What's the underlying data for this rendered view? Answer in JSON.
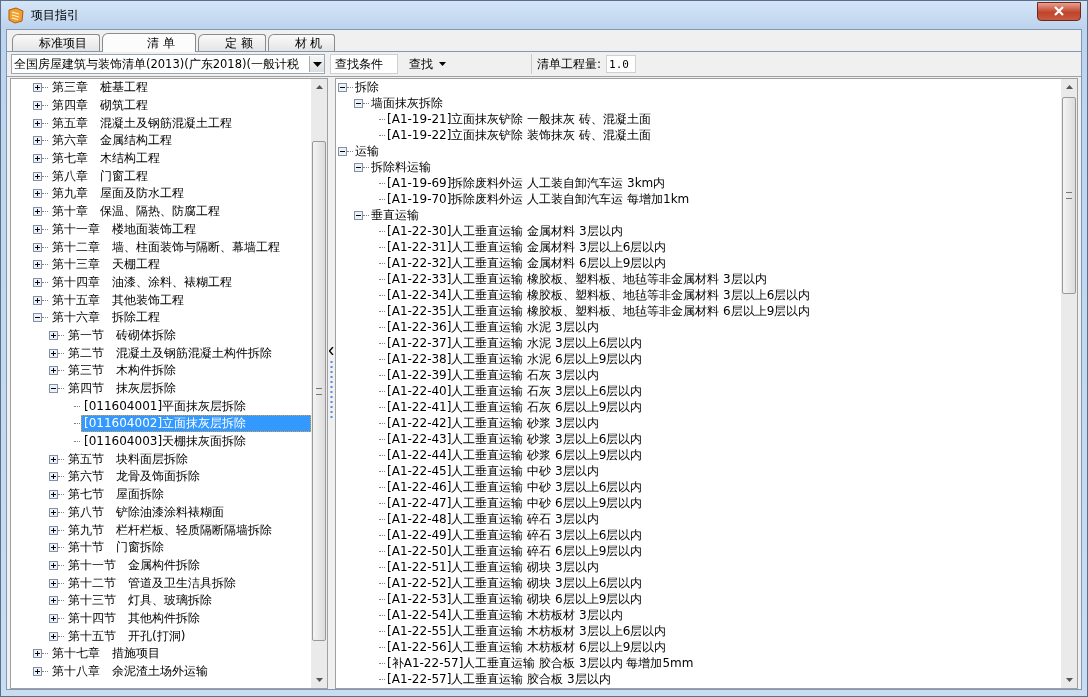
{
  "window": {
    "title": "项目指引"
  },
  "tabs": [
    {
      "label": "标准项目",
      "selected": false
    },
    {
      "label": "清 单",
      "selected": true
    },
    {
      "label": "定 额",
      "selected": false
    },
    {
      "label": "材 机",
      "selected": false
    }
  ],
  "toolbar": {
    "library": "全国房屋建筑与装饰清单(2013)(广东2018)(一般计税",
    "search_condition": "查找条件",
    "find_button": "查找",
    "quantity_label": "清单工程量:",
    "quantity_value": "1.0"
  },
  "left_tree": [
    {
      "label": "第三章　桩基工程",
      "expanded": false,
      "selected": false
    },
    {
      "label": "第四章　砌筑工程",
      "expanded": false,
      "selected": false
    },
    {
      "label": "第五章　混凝土及钢筋混凝土工程",
      "expanded": false,
      "selected": false
    },
    {
      "label": "第六章　金属结构工程",
      "expanded": false,
      "selected": false
    },
    {
      "label": "第七章　木结构工程",
      "expanded": false,
      "selected": false
    },
    {
      "label": "第八章　门窗工程",
      "expanded": false,
      "selected": false
    },
    {
      "label": "第九章　屋面及防水工程",
      "expanded": false,
      "selected": false
    },
    {
      "label": "第十章　保温、隔热、防腐工程",
      "expanded": false,
      "selected": false
    },
    {
      "label": "第十一章　楼地面装饰工程",
      "expanded": false,
      "selected": false
    },
    {
      "label": "第十二章　墙、柱面装饰与隔断、幕墙工程",
      "expanded": false,
      "selected": false
    },
    {
      "label": "第十三章　天棚工程",
      "expanded": false,
      "selected": false
    },
    {
      "label": "第十四章　油漆、涂料、裱糊工程",
      "expanded": false,
      "selected": false
    },
    {
      "label": "第十五章　其他装饰工程",
      "expanded": false,
      "selected": false
    },
    {
      "label": "第十六章　拆除工程",
      "expanded": true,
      "selected": false,
      "children": [
        {
          "label": "第一节　砖砌体拆除",
          "expanded": false,
          "selected": false
        },
        {
          "label": "第二节　混凝土及钢筋混凝土构件拆除",
          "expanded": false,
          "selected": false
        },
        {
          "label": "第三节　木构件拆除",
          "expanded": false,
          "selected": false
        },
        {
          "label": "第四节　抹灰层拆除",
          "expanded": true,
          "selected": false,
          "children": [
            {
              "label": "[011604001]平面抹灰层拆除",
              "selected": false
            },
            {
              "label": "[011604002]立面抹灰层拆除",
              "selected": true
            },
            {
              "label": "[011604003]天棚抹灰面拆除",
              "selected": false
            }
          ]
        },
        {
          "label": "第五节　块料面层拆除",
          "expanded": false,
          "selected": false
        },
        {
          "label": "第六节　龙骨及饰面拆除",
          "expanded": false,
          "selected": false
        },
        {
          "label": "第七节　屋面拆除",
          "expanded": false,
          "selected": false
        },
        {
          "label": "第八节　铲除油漆涂料裱糊面",
          "expanded": false,
          "selected": false
        },
        {
          "label": "第九节　栏杆栏板、轻质隔断隔墙拆除",
          "expanded": false,
          "selected": false
        },
        {
          "label": "第十节　门窗拆除",
          "expanded": false,
          "selected": false
        },
        {
          "label": "第十一节　金属构件拆除",
          "expanded": false,
          "selected": false
        },
        {
          "label": "第十二节　管道及卫生洁具拆除",
          "expanded": false,
          "selected": false
        },
        {
          "label": "第十三节　灯具、玻璃拆除",
          "expanded": false,
          "selected": false
        },
        {
          "label": "第十四节　其他构件拆除",
          "expanded": false,
          "selected": false
        },
        {
          "label": "第十五节　开孔(打洞)",
          "expanded": false,
          "selected": false
        }
      ]
    },
    {
      "label": "第十七章　措施项目",
      "expanded": false,
      "selected": false
    },
    {
      "label": "第十八章　余泥渣土场外运输",
      "expanded": false,
      "selected": false
    }
  ],
  "right_tree": [
    {
      "label": "拆除",
      "expanded": true,
      "children": [
        {
          "label": "墙面抹灰拆除",
          "expanded": true,
          "children": [
            {
              "label": "[A1-19-21]立面抹灰铲除 一般抹灰 砖、混凝土面"
            },
            {
              "label": "[A1-19-22]立面抹灰铲除 装饰抹灰 砖、混凝土面"
            }
          ]
        }
      ]
    },
    {
      "label": "运输",
      "expanded": true,
      "children": [
        {
          "label": "拆除料运输",
          "expanded": true,
          "children": [
            {
              "label": "[A1-19-69]拆除废料外运 人工装自卸汽车运 3km内"
            },
            {
              "label": "[A1-19-70]拆除废料外运 人工装自卸汽车运 每增加1km"
            }
          ]
        },
        {
          "label": "垂直运输",
          "expanded": true,
          "children": [
            {
              "label": "[A1-22-30]人工垂直运输 金属材料 3层以内"
            },
            {
              "label": "[A1-22-31]人工垂直运输 金属材料 3层以上6层以内"
            },
            {
              "label": "[A1-22-32]人工垂直运输 金属材料 6层以上9层以内"
            },
            {
              "label": "[A1-22-33]人工垂直运输 橡胶板、塑料板、地毡等非金属材料 3层以内"
            },
            {
              "label": "[A1-22-34]人工垂直运输 橡胶板、塑料板、地毡等非金属材料 3层以上6层以内"
            },
            {
              "label": "[A1-22-35]人工垂直运输 橡胶板、塑料板、地毡等非金属材料 6层以上9层以内"
            },
            {
              "label": "[A1-22-36]人工垂直运输 水泥 3层以内"
            },
            {
              "label": "[A1-22-37]人工垂直运输 水泥 3层以上6层以内"
            },
            {
              "label": "[A1-22-38]人工垂直运输 水泥 6层以上9层以内"
            },
            {
              "label": "[A1-22-39]人工垂直运输 石灰 3层以内"
            },
            {
              "label": "[A1-22-40]人工垂直运输 石灰 3层以上6层以内"
            },
            {
              "label": "[A1-22-41]人工垂直运输 石灰 6层以上9层以内"
            },
            {
              "label": "[A1-22-42]人工垂直运输 砂浆 3层以内"
            },
            {
              "label": "[A1-22-43]人工垂直运输 砂浆 3层以上6层以内"
            },
            {
              "label": "[A1-22-44]人工垂直运输 砂浆 6层以上9层以内"
            },
            {
              "label": "[A1-22-45]人工垂直运输 中砂 3层以内"
            },
            {
              "label": "[A1-22-46]人工垂直运输 中砂 3层以上6层以内"
            },
            {
              "label": "[A1-22-47]人工垂直运输 中砂 6层以上9层以内"
            },
            {
              "label": "[A1-22-48]人工垂直运输 碎石 3层以内"
            },
            {
              "label": "[A1-22-49]人工垂直运输 碎石 3层以上6层以内"
            },
            {
              "label": "[A1-22-50]人工垂直运输 碎石 6层以上9层以内"
            },
            {
              "label": "[A1-22-51]人工垂直运输 砌块 3层以内"
            },
            {
              "label": "[A1-22-52]人工垂直运输 砌块 3层以上6层以内"
            },
            {
              "label": "[A1-22-53]人工垂直运输 砌块 6层以上9层以内"
            },
            {
              "label": "[A1-22-54]人工垂直运输 木枋板材 3层以内"
            },
            {
              "label": "[A1-22-55]人工垂直运输 木枋板材 3层以上6层以内"
            },
            {
              "label": "[A1-22-56]人工垂直运输 木枋板材 6层以上9层以内"
            },
            {
              "label": "[补A1-22-57]人工垂直运输 胶合板 3层以内 每增加5mm"
            },
            {
              "label": "[A1-22-57]人工垂直运输 胶合板 3层以内"
            }
          ]
        }
      ]
    }
  ]
}
